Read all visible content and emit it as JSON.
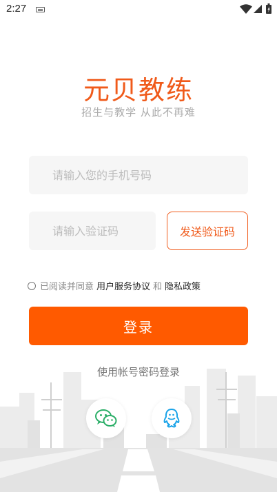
{
  "status": {
    "time": "2:27"
  },
  "brand": {
    "name": "元贝教练",
    "slogan": "招生与教学  从此不再难"
  },
  "form": {
    "phone_placeholder": "请输入您的手机号码",
    "code_placeholder": "请输入验证码",
    "send_code_label": "发送验证码"
  },
  "agreement": {
    "prefix": "已阅读并同意",
    "terms": "用户服务协议",
    "and": "和",
    "privacy": "隐私政策"
  },
  "login_label": "登录",
  "password_login_label": "使用帐号密码登录",
  "social": {
    "wechat_icon": "wechat-icon",
    "qq_icon": "qq-icon"
  },
  "colors": {
    "accent": "#ff5a00",
    "brand": "#f05a1a",
    "wechat": "#2aae67",
    "qq": "#1aa3e8"
  }
}
